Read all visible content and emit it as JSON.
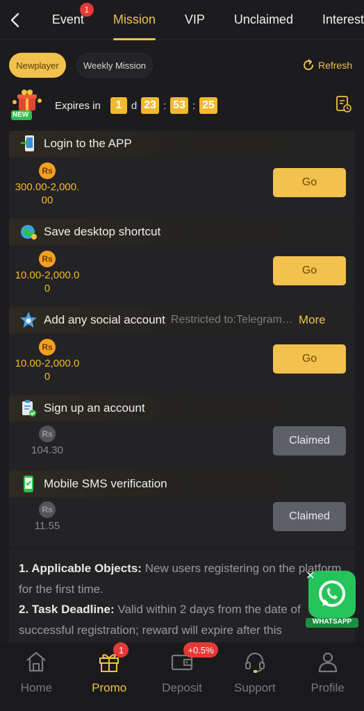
{
  "topnav": {
    "tabs": [
      {
        "label": "Event",
        "badge": "1"
      },
      {
        "label": "Mission"
      },
      {
        "label": "VIP"
      },
      {
        "label": "Unclaimed"
      },
      {
        "label": "Interest"
      }
    ]
  },
  "subtabs": {
    "newplayer": "Newplayer",
    "weekly": "Weekly Mission",
    "refresh": "Refresh"
  },
  "expires": {
    "label": "Expires in",
    "days": "1",
    "day_unit": "d",
    "hours": "23",
    "minutes": "53",
    "seconds": "25",
    "badge_text": "NEW"
  },
  "currency_symbol": "Rs",
  "tasks": [
    {
      "title": "Login to the APP",
      "amount": "300.00-2,000.00",
      "button": "Go"
    },
    {
      "title": "Save desktop shortcut",
      "amount": "10.00-2,000.00",
      "button": "Go"
    },
    {
      "title": "Add any social account",
      "restriction": "Restricted to:Telegram…",
      "more": "More",
      "amount": "10.00-2,000.00",
      "button": "Go"
    },
    {
      "title": "Sign up an account",
      "amount": "104.30",
      "button": "Claimed"
    },
    {
      "title": "Mobile SMS verification",
      "amount": "11.55",
      "button": "Claimed"
    }
  ],
  "rules": {
    "item1_title": "1. Applicable Objects:",
    "item1_text": " New users registering on the platform for the first time.",
    "item2_title": "2. Task Deadline:",
    "item2_text": " Valid within 2 days from the date of successful registration; reward will expire after this"
  },
  "whatsapp": {
    "label": "WHATSAPP"
  },
  "bottomnav": {
    "items": [
      {
        "label": "Home"
      },
      {
        "label": "Promo",
        "badge": "1"
      },
      {
        "label": "Deposit",
        "badge": "+0.5%"
      },
      {
        "label": "Support"
      },
      {
        "label": "Profile"
      }
    ]
  },
  "colors": {
    "accent": "#f2c14e",
    "badge": "#e53935",
    "claimed": "#5e6068",
    "background": "#1c1c1e"
  }
}
